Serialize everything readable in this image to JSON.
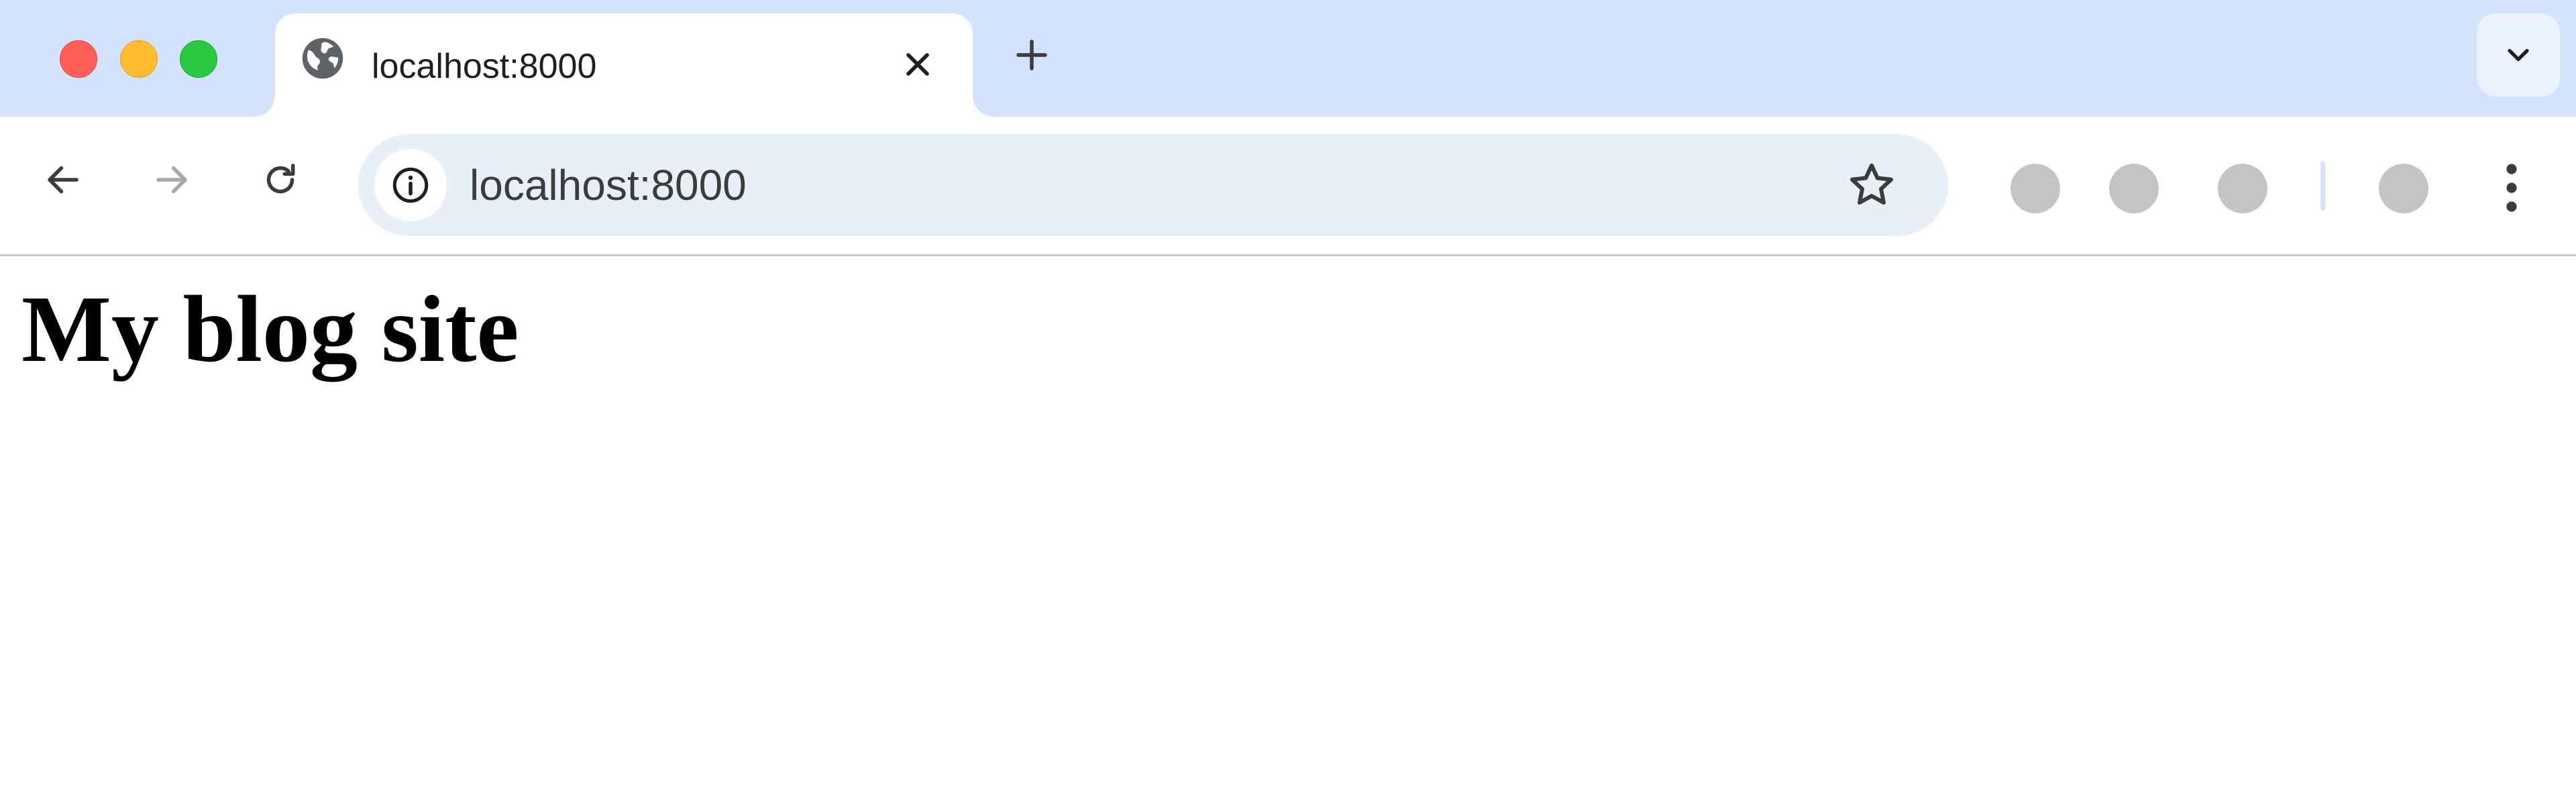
{
  "window": {
    "traffic_lights": [
      "close",
      "minimize",
      "maximize"
    ]
  },
  "tabs": [
    {
      "title": "localhost:8000",
      "favicon": "globe-icon",
      "active": true
    }
  ],
  "toolbar": {
    "address": "localhost:8000",
    "site_info_icon": "info-icon",
    "bookmark_icon": "star-icon",
    "extension_count": 4,
    "menu_icon": "kebab-menu-icon"
  },
  "page": {
    "heading": "My blog site"
  },
  "colors": {
    "tabstrip_bg": "#d3e3fd",
    "omnibox_bg": "#e9eff8",
    "close": "#ff5f57",
    "minimize": "#febc2e",
    "maximize": "#28c840"
  }
}
